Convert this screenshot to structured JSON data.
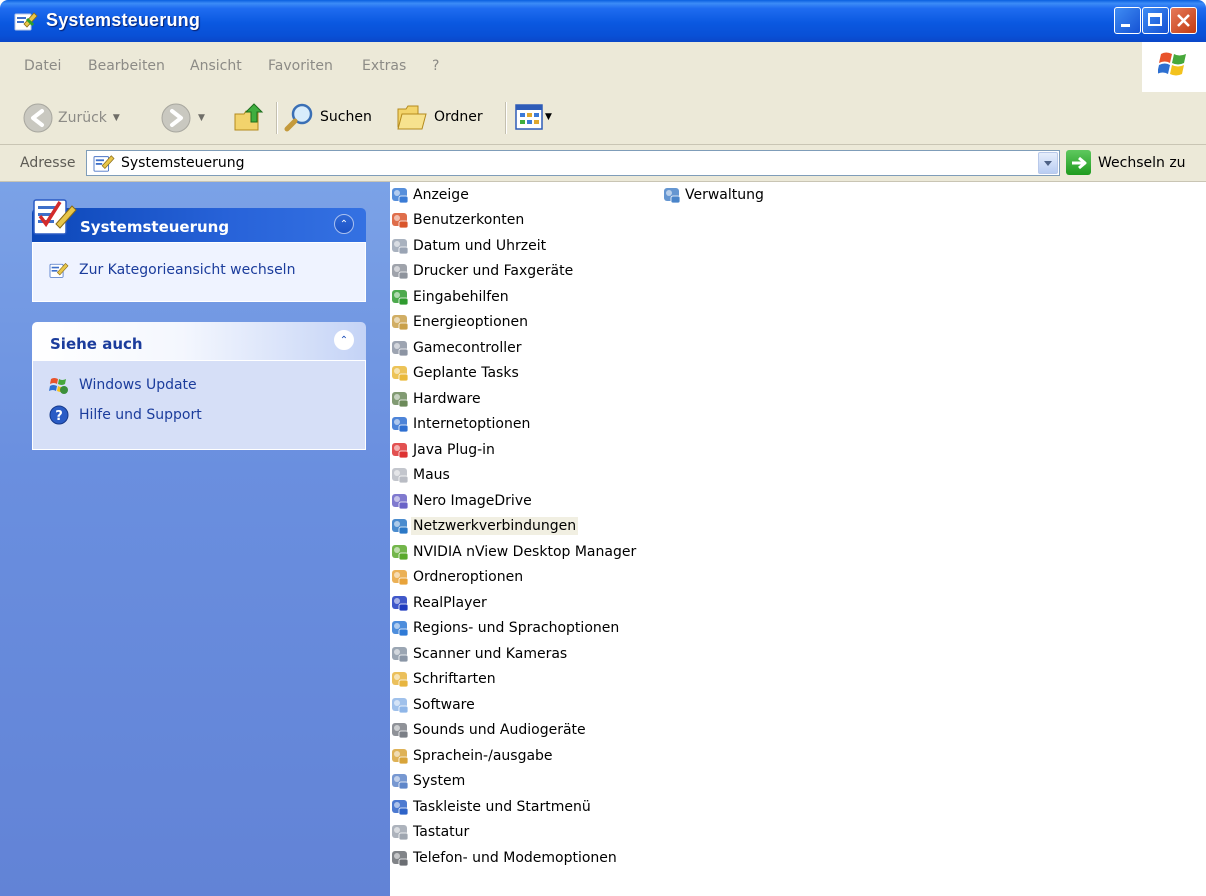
{
  "window": {
    "title": "Systemsteuerung",
    "accent": "#0a58e0"
  },
  "menu": {
    "items": [
      "Datei",
      "Bearbeiten",
      "Ansicht",
      "Favoriten",
      "Extras",
      "?"
    ]
  },
  "toolbar": {
    "back_label": "Zurück",
    "search_label": "Suchen",
    "folders_label": "Ordner"
  },
  "address": {
    "label": "Adresse",
    "value": "Systemsteuerung",
    "go_label": "Wechseln zu"
  },
  "tasks": {
    "panel_title": "Systemsteuerung",
    "switch_view": "Zur Kategorieansicht wechseln",
    "see_also_title": "Siehe auch",
    "see_also": [
      {
        "label": "Windows Update",
        "icon": "windows-update-icon"
      },
      {
        "label": "Hilfe und Support",
        "icon": "help-icon"
      }
    ]
  },
  "items": [
    {
      "label": "Anzeige",
      "icon": "display-icon",
      "color": "#3a7bd5"
    },
    {
      "label": "Benutzerkonten",
      "icon": "user-accounts-icon",
      "color": "#d9552b"
    },
    {
      "label": "Datum und Uhrzeit",
      "icon": "clock-icon",
      "color": "#9aa4b4"
    },
    {
      "label": "Drucker und Faxgeräte",
      "icon": "printer-icon",
      "color": "#8e939c"
    },
    {
      "label": "Eingabehilfen",
      "icon": "accessibility-icon",
      "color": "#2f9b2f"
    },
    {
      "label": "Energieoptionen",
      "icon": "power-icon",
      "color": "#c9a04a"
    },
    {
      "label": "Gamecontroller",
      "icon": "gamepad-icon",
      "color": "#8c94a3"
    },
    {
      "label": "Geplante Tasks",
      "icon": "scheduled-tasks-icon",
      "color": "#e9b93b"
    },
    {
      "label": "Hardware",
      "icon": "hardware-icon",
      "color": "#6c8a5a"
    },
    {
      "label": "Internetoptionen",
      "icon": "globe-icon",
      "color": "#2e6fd1"
    },
    {
      "label": "Java Plug-in",
      "icon": "java-icon",
      "color": "#d33"
    },
    {
      "label": "Maus",
      "icon": "mouse-icon",
      "color": "#b9bcc4"
    },
    {
      "label": "Nero ImageDrive",
      "icon": "disc-icon",
      "color": "#6a63c7"
    },
    {
      "label": "Netzwerkverbindungen",
      "icon": "network-icon",
      "color": "#2b78c6"
    },
    {
      "label": "NVIDIA nView Desktop Manager",
      "icon": "nvidia-icon",
      "color": "#5aa92c"
    },
    {
      "label": "Ordneroptionen",
      "icon": "folder-options-icon",
      "color": "#e8a33a"
    },
    {
      "label": "RealPlayer",
      "icon": "realplayer-icon",
      "color": "#1f3bbf"
    },
    {
      "label": "Regions- und Sprachoptionen",
      "icon": "regional-icon",
      "color": "#2f7ad6"
    },
    {
      "label": "Scanner und Kameras",
      "icon": "scanner-icon",
      "color": "#8a96a6"
    },
    {
      "label": "Schriftarten",
      "icon": "fonts-folder-icon",
      "color": "#e7b540"
    },
    {
      "label": "Software",
      "icon": "software-icon",
      "color": "#8fb6e8"
    },
    {
      "label": "Sounds und Audiogeräte",
      "icon": "speaker-icon",
      "color": "#7b7f86"
    },
    {
      "label": "Sprachein-/ausgabe",
      "icon": "speech-icon",
      "color": "#d8a43a"
    },
    {
      "label": "System",
      "icon": "system-icon",
      "color": "#5f86c9"
    },
    {
      "label": "Taskleiste und Startmenü",
      "icon": "taskbar-icon",
      "color": "#2e63c8"
    },
    {
      "label": "Tastatur",
      "icon": "keyboard-icon",
      "color": "#9fa6b0"
    },
    {
      "label": "Telefon- und Modemoptionen",
      "icon": "phone-icon",
      "color": "#6b6e73"
    },
    {
      "label": "Verwaltung",
      "icon": "admin-tools-icon",
      "color": "#4a84c9"
    }
  ],
  "hovered_item": "Netzwerkverbindungen"
}
